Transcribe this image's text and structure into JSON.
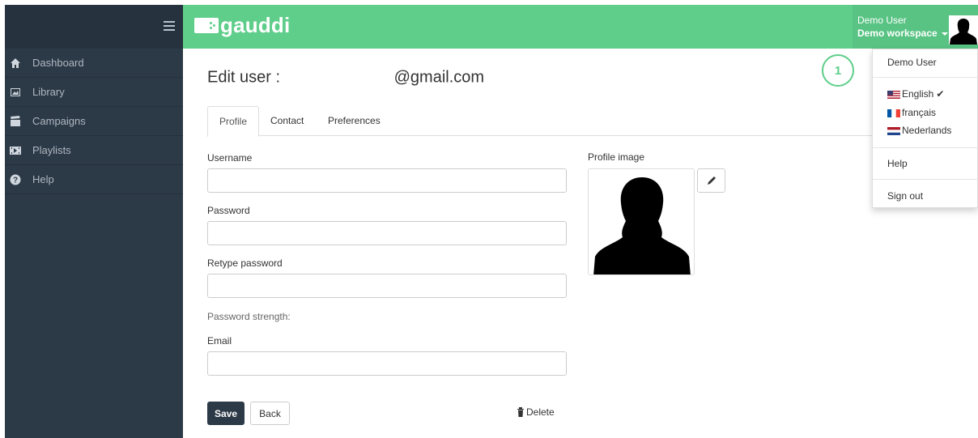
{
  "colors": {
    "brand": "#5fce8a",
    "sidebar": "#2c3946",
    "primary_button": "#2c3946"
  },
  "sidebar": {
    "menu_icon": "hamburger-icon",
    "items": [
      {
        "label": "Dashboard",
        "icon": "home-icon"
      },
      {
        "label": "Library",
        "icon": "image-icon"
      },
      {
        "label": "Campaigns",
        "icon": "clapperboard-icon"
      },
      {
        "label": "Playlists",
        "icon": "film-icon"
      },
      {
        "label": "Help",
        "icon": "question-icon"
      }
    ]
  },
  "header": {
    "logo_text": "gauddi",
    "user_name": "Demo User",
    "workspace": "Demo workspace"
  },
  "page": {
    "title_prefix": "Edit user :",
    "title_suffix": "@gmail.com",
    "tabs": [
      {
        "label": "Profile",
        "active": true
      },
      {
        "label": "Contact",
        "active": false
      },
      {
        "label": "Preferences",
        "active": false
      }
    ],
    "form": {
      "username_label": "Username",
      "password_label": "Password",
      "retype_label": "Retype password",
      "strength_label": "Password strength:",
      "email_label": "Email"
    },
    "profile_image_label": "Profile image",
    "save_label": "Save",
    "back_label": "Back",
    "delete_label": "Delete"
  },
  "dropdown": {
    "user": "Demo User",
    "languages": [
      {
        "label": "English",
        "selected": true,
        "flag": "us-flag-icon"
      },
      {
        "label": "français",
        "selected": false,
        "flag": "fr-flag-icon"
      },
      {
        "label": "Nederlands",
        "selected": false,
        "flag": "nl-flag-icon"
      }
    ],
    "help": "Help",
    "sign_out": "Sign out"
  },
  "callout": "1"
}
